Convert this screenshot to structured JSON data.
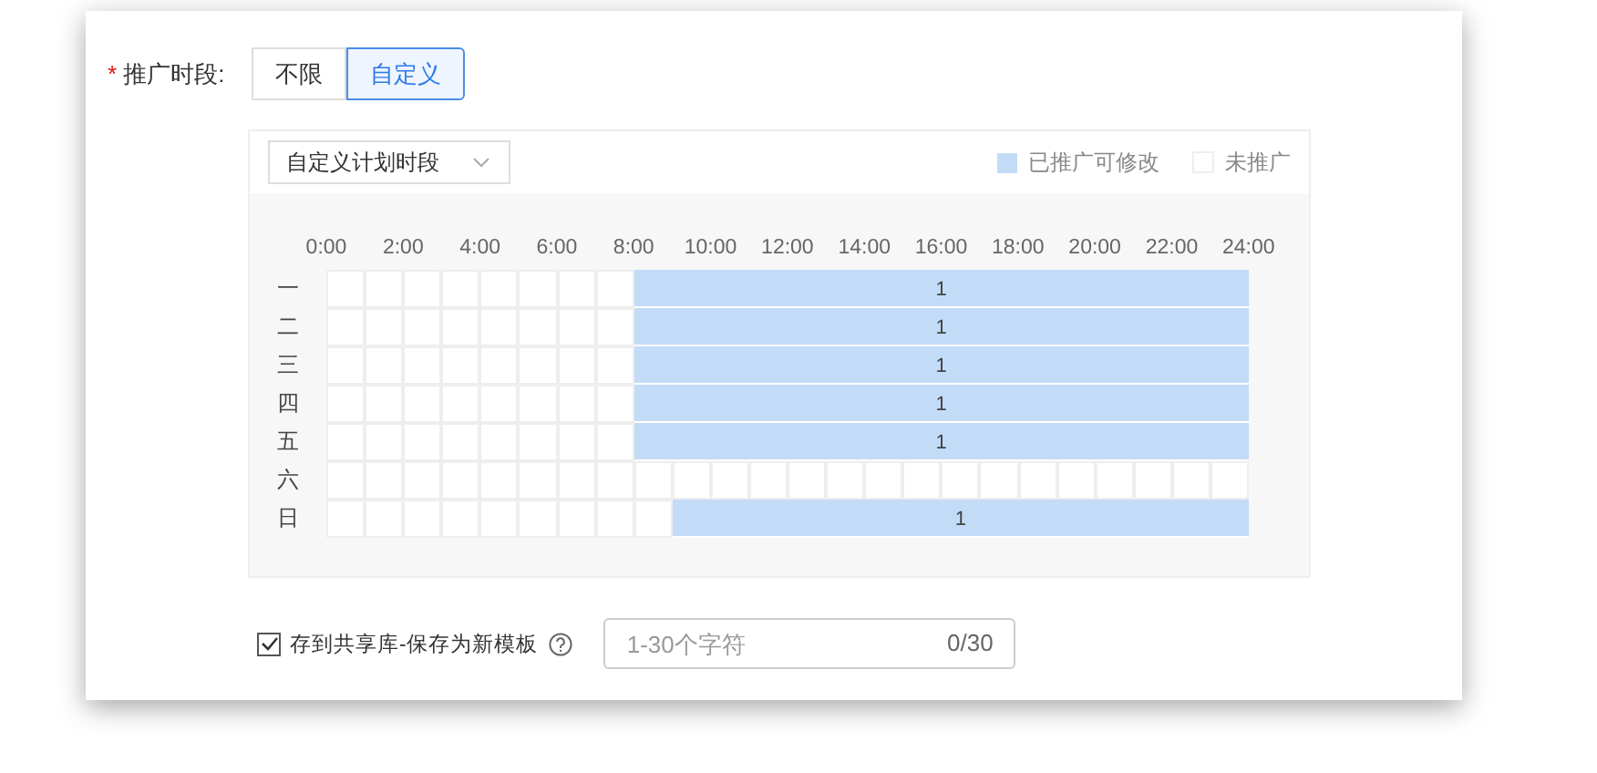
{
  "field_label": {
    "required_mark": "*",
    "text": "推广时段:"
  },
  "tabs": [
    {
      "label": "不限",
      "selected": false
    },
    {
      "label": "自定义",
      "selected": true
    }
  ],
  "schedule": {
    "dropdown": {
      "value": "自定义计划时段"
    },
    "legend": [
      {
        "label": "已推广可修改",
        "kind": "active"
      },
      {
        "label": "未推广",
        "kind": "inactive"
      }
    ],
    "hours": [
      "0:00",
      "2:00",
      "4:00",
      "6:00",
      "8:00",
      "10:00",
      "12:00",
      "14:00",
      "16:00",
      "18:00",
      "20:00",
      "22:00",
      "24:00"
    ],
    "rows": [
      {
        "day": "一",
        "segment_label": "1",
        "hours_on": [
          false,
          false,
          false,
          false,
          false,
          false,
          false,
          false,
          true,
          true,
          true,
          true,
          true,
          true,
          true,
          true,
          true,
          true,
          true,
          true,
          true,
          true,
          true,
          true
        ]
      },
      {
        "day": "二",
        "segment_label": "1",
        "hours_on": [
          false,
          false,
          false,
          false,
          false,
          false,
          false,
          false,
          true,
          true,
          true,
          true,
          true,
          true,
          true,
          true,
          true,
          true,
          true,
          true,
          true,
          true,
          true,
          true
        ]
      },
      {
        "day": "三",
        "segment_label": "1",
        "hours_on": [
          false,
          false,
          false,
          false,
          false,
          false,
          false,
          false,
          true,
          true,
          true,
          true,
          true,
          true,
          true,
          true,
          true,
          true,
          true,
          true,
          true,
          true,
          true,
          true
        ]
      },
      {
        "day": "四",
        "segment_label": "1",
        "hours_on": [
          false,
          false,
          false,
          false,
          false,
          false,
          false,
          false,
          true,
          true,
          true,
          true,
          true,
          true,
          true,
          true,
          true,
          true,
          true,
          true,
          true,
          true,
          true,
          true
        ]
      },
      {
        "day": "五",
        "segment_label": "1",
        "hours_on": [
          false,
          false,
          false,
          false,
          false,
          false,
          false,
          false,
          true,
          true,
          true,
          true,
          true,
          true,
          true,
          true,
          true,
          true,
          true,
          true,
          true,
          true,
          true,
          true
        ]
      },
      {
        "day": "六",
        "hours_on": [
          false,
          false,
          false,
          false,
          false,
          false,
          false,
          false,
          false,
          false,
          false,
          false,
          false,
          false,
          false,
          false,
          false,
          false,
          false,
          false,
          false,
          false,
          false,
          false
        ]
      },
      {
        "day": "日",
        "segment_label": "1",
        "hours_on": [
          false,
          false,
          false,
          false,
          false,
          false,
          false,
          false,
          false,
          true,
          true,
          true,
          true,
          true,
          true,
          true,
          true,
          true,
          true,
          true,
          true,
          true,
          true,
          true
        ]
      }
    ]
  },
  "save_template": {
    "checked": true,
    "label": "存到共享库-保存为新模板",
    "placeholder": "1-30个字符",
    "counter": "0/30"
  }
}
